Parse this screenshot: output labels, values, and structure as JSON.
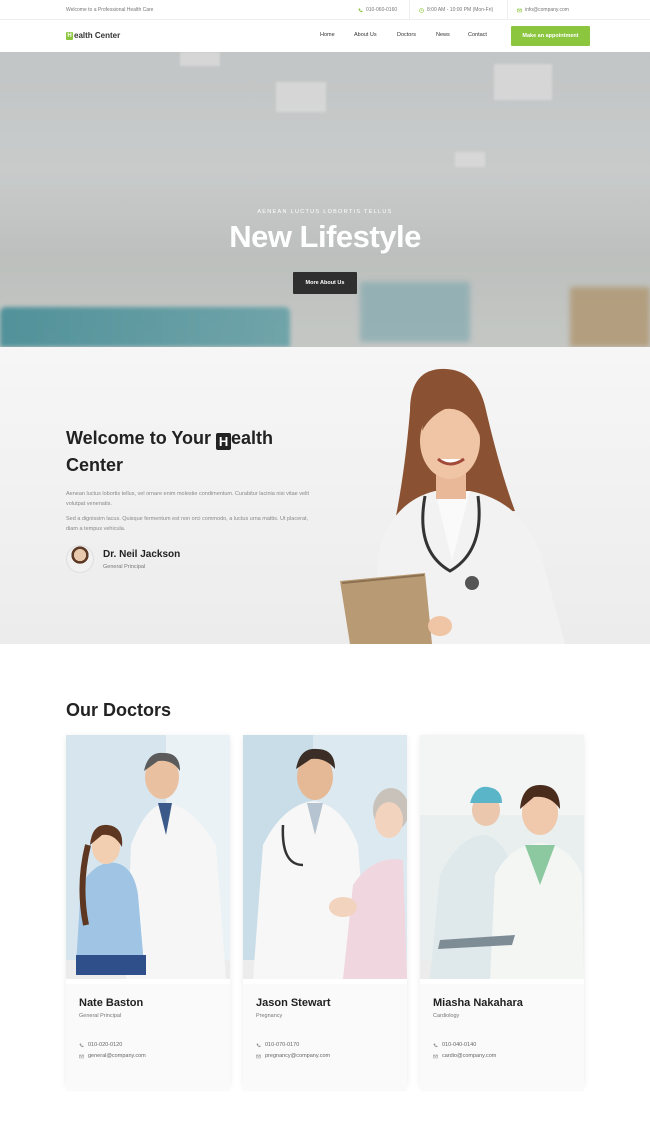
{
  "topbar": {
    "welcome": "Welcome to a Professional Health Care",
    "phone": "010-060-0160",
    "hours": "8:00 AM - 10:00 PM (Mon-Fri)",
    "email": "info@company.com"
  },
  "nav": {
    "logo_letter": "H",
    "logo_text": "ealth Center",
    "items": [
      "Home",
      "About Us",
      "Doctors",
      "News",
      "Contact"
    ],
    "cta": "Make an appointment"
  },
  "hero": {
    "kicker": "Aenean luctus lobortis tellus",
    "title": "New Lifestyle",
    "button": "More About Us",
    "slides": 3,
    "active_slide": 2
  },
  "welcome": {
    "title_pre": "Welcome to Your ",
    "title_letter": "H",
    "title_post": "ealth Center",
    "p1": "Aenean luctus lobortis tellus, vel ornare enim molestie condimentum. Curabitur lacinia nisi vitae velit volutpat venenatis.",
    "p2": "Sed a dignissim lacus. Quisque fermentum est non orci commodo, a luctus urna mattis. Ut placerat, diam a tempus vehicula.",
    "doctor_name": "Dr. Neil Jackson",
    "doctor_role": "General Principal"
  },
  "doctors": {
    "title": "Our Doctors",
    "cards": [
      {
        "name": "Nate Baston",
        "role": "General Principal",
        "phone": "010-020-0120",
        "email": "general@company.com"
      },
      {
        "name": "Jason Stewart",
        "role": "Pregnancy",
        "phone": "010-070-0170",
        "email": "pregnancy@company.com"
      },
      {
        "name": "Miasha Nakahara",
        "role": "Cardiology",
        "phone": "010-040-0140",
        "email": "cardio@company.com"
      }
    ]
  },
  "colors": {
    "accent": "#8cc63f",
    "dark": "#2f2f2f"
  }
}
